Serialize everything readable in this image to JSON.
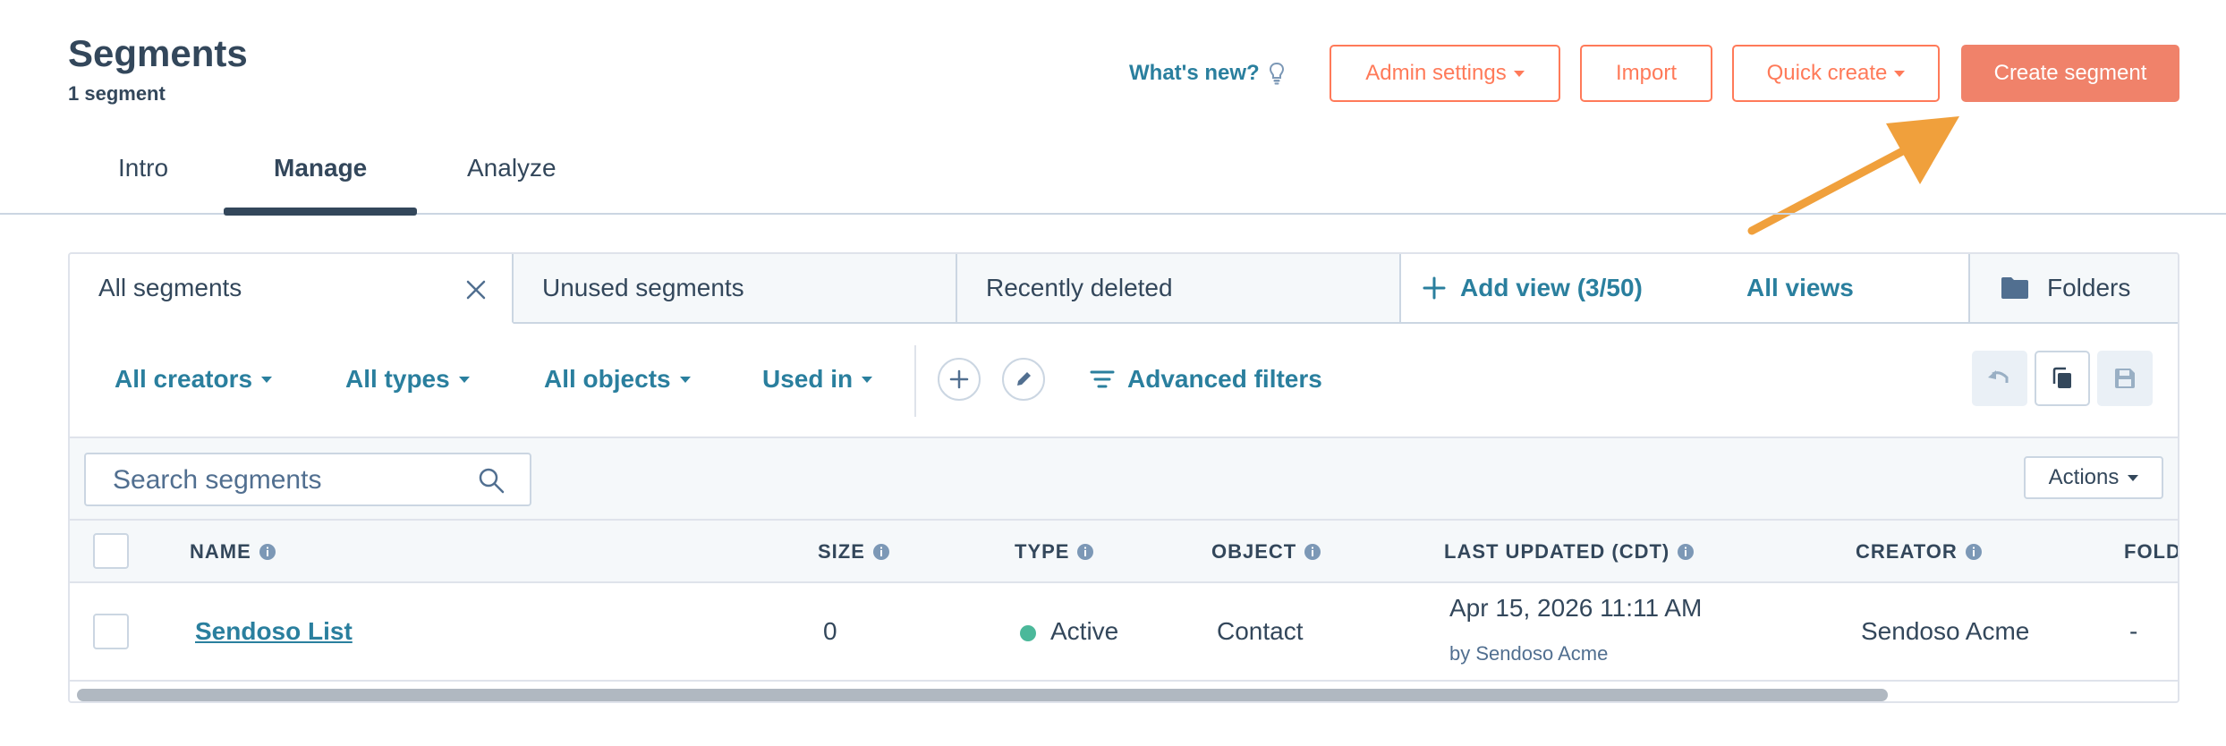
{
  "header": {
    "title": "Segments",
    "subtitle": "1 segment",
    "whats_new": "What's new?",
    "admin_settings": "Admin settings",
    "import": "Import",
    "quick_create": "Quick create",
    "create_segment": "Create segment"
  },
  "tabs": [
    {
      "label": "Intro"
    },
    {
      "label": "Manage",
      "active": true
    },
    {
      "label": "Analyze"
    }
  ],
  "views": {
    "tabs": [
      "All segments",
      "Unused segments",
      "Recently deleted"
    ],
    "add_view": "Add view (3/50)",
    "all_views": "All views",
    "folders": "Folders"
  },
  "filters": {
    "creators": "All creators",
    "types": "All types",
    "objects": "All objects",
    "used_in": "Used in",
    "advanced": "Advanced filters"
  },
  "search": {
    "placeholder": "Search segments"
  },
  "actions": "Actions",
  "table": {
    "columns": [
      "NAME",
      "SIZE",
      "TYPE",
      "OBJECT",
      "LAST UPDATED (CDT)",
      "CREATOR",
      "FOLD"
    ],
    "rows": [
      {
        "name": "Sendoso List",
        "size": "0",
        "type": "Active",
        "object": "Contact",
        "last_updated": "Apr 15, 2026 11:11 AM",
        "updated_by": "by Sendoso Acme",
        "creator": "Sendoso Acme",
        "folder": "-"
      }
    ]
  },
  "colors": {
    "accent": "#ff7a59",
    "primary_button": "#f0826a",
    "link": "#2a7f9e",
    "text": "#33475b",
    "status_active": "#4bb89a",
    "arrow": "#f0a03c"
  }
}
